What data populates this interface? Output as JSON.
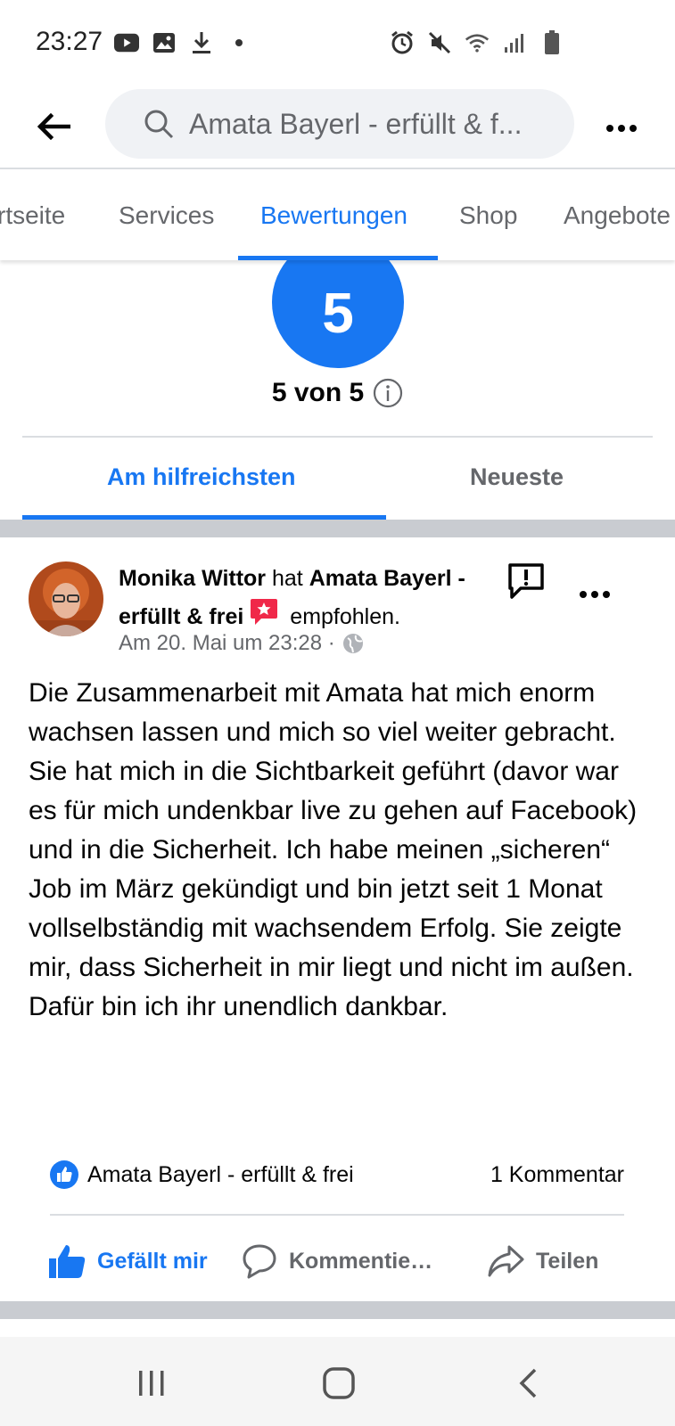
{
  "status_bar": {
    "time": "23:27"
  },
  "header": {
    "search_text": "Amata Bayerl - erfüllt & f..."
  },
  "tabs": [
    {
      "label": "rtseite"
    },
    {
      "label": "Services"
    },
    {
      "label": "Bewertungen"
    },
    {
      "label": "Shop"
    },
    {
      "label": "Angebote"
    }
  ],
  "rating": {
    "value": "5",
    "summary": "5 von 5"
  },
  "sort_tabs": {
    "helpful": "Am hilfreichsten",
    "newest": "Neueste"
  },
  "review": {
    "author": "Monika Wittor",
    "verb": "hat",
    "page_name": "Amata Bayerl - erfüllt & frei",
    "recommended": "empfohlen.",
    "timestamp": "Am 20. Mai um 23:28 ·",
    "body": "Die Zusammenarbeit mit Amata hat mich enorm wachsen lassen und mich so viel weiter gebracht. Sie hat mich in die Sichtbarkeit geführt (davor war es für mich undenkbar live zu gehen auf Facebook) und in die Sicherheit. Ich habe meinen „sicheren“ Job im März gekündigt und bin jetzt seit 1 Monat vollselbständig mit wachsendem Erfolg. Sie zeigte mir, dass Sicherheit in mir liegt und nicht im außen. Dafür bin ich ihr unendlich dankbar.",
    "liked_by": "Amata Bayerl - erfüllt & frei",
    "comment_count": "1 Kommentar"
  },
  "actions": {
    "like": "Gefällt mir",
    "comment": "Kommentie…",
    "share": "Teilen"
  },
  "colors": {
    "accent": "#1877f2",
    "secondary_text": "#65676b",
    "recommend_badge": "#f02849"
  }
}
